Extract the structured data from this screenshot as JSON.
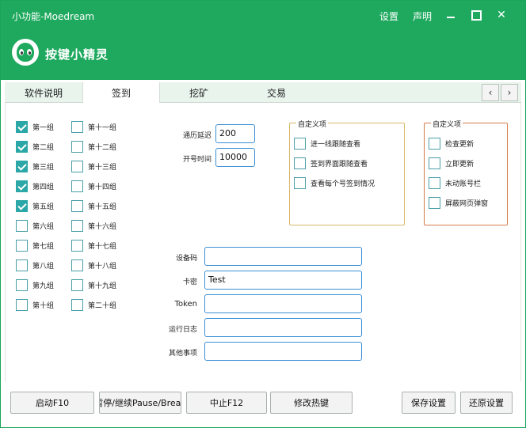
{
  "window": {
    "title": "小功能-Moedream",
    "links": [
      "设置",
      "声明"
    ],
    "app_name": "按键小精灵"
  },
  "tabs": [
    "软件说明",
    "签到",
    "挖矿",
    "交易"
  ],
  "groups_left": [
    {
      "label": "第一组",
      "checked": true
    },
    {
      "label": "第二组",
      "checked": true
    },
    {
      "label": "第三组",
      "checked": true
    },
    {
      "label": "第四组",
      "checked": true
    },
    {
      "label": "第五组",
      "checked": true
    },
    {
      "label": "第六组",
      "checked": false
    },
    {
      "label": "第七组",
      "checked": false
    },
    {
      "label": "第八组",
      "checked": false
    },
    {
      "label": "第九组",
      "checked": false
    },
    {
      "label": "第十组",
      "checked": false
    }
  ],
  "groups_right": [
    {
      "label": "第十一组",
      "checked": false
    },
    {
      "label": "第十二组",
      "checked": false
    },
    {
      "label": "第十三组",
      "checked": false
    },
    {
      "label": "第十四组",
      "checked": false
    },
    {
      "label": "第十五组",
      "checked": false
    },
    {
      "label": "第十六组",
      "checked": false
    },
    {
      "label": "第十七组",
      "checked": false
    },
    {
      "label": "第十八组",
      "checked": false
    },
    {
      "label": "第十九组",
      "checked": false
    },
    {
      "label": "第二十组",
      "checked": false
    }
  ],
  "settings": {
    "delay_label": "通历延迟",
    "delay_value": "200",
    "open_label": "开号时间",
    "open_value": "10000"
  },
  "custom1": {
    "title": "自定义项",
    "options": [
      "进一线跟随查看",
      "签到界面跟随查看",
      "查看每个号签到情况"
    ]
  },
  "custom2": {
    "title": "自定义项",
    "options": [
      "检查更新",
      "立即更新",
      "未动账号栏",
      "屏蔽网页弹窗"
    ]
  },
  "fields": [
    {
      "label": "设备码",
      "value": ""
    },
    {
      "label": "卡密",
      "value": "Test"
    },
    {
      "label": "Token",
      "value": ""
    },
    {
      "label": "运行日志",
      "value": ""
    },
    {
      "label": "其他事项",
      "value": ""
    }
  ],
  "buttons": {
    "start": "启动F10",
    "pause": "暂停/继续Pause/Break",
    "stop": "中止F12",
    "hotkey": "修改热键",
    "save": "保存设置",
    "restore": "还原设置"
  }
}
